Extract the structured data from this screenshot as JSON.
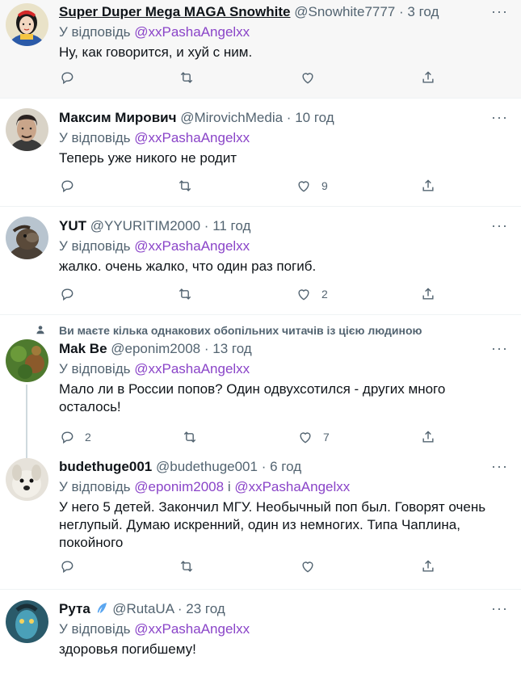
{
  "tweets": [
    {
      "name": "Super Duper Mega MAGA Snowhite",
      "handle": "@Snowhite7777",
      "time": "3 год",
      "reply_prefix": "У відповідь",
      "reply_to": "@xxPashaAngelxx",
      "reply_and": "",
      "reply_to2": "",
      "text": "Ну, как говорится, и хуй с ним.",
      "likes": ""
    },
    {
      "name": "Максим Мирович",
      "handle": "@MirovichMedia",
      "time": "10 год",
      "reply_prefix": "У відповідь",
      "reply_to": "@xxPashaAngelxx",
      "reply_and": "",
      "reply_to2": "",
      "text": "Теперь уже никого не родит",
      "likes": "9"
    },
    {
      "name": "YUT",
      "handle": "@YYURITIM2000",
      "time": "11 год",
      "reply_prefix": "У відповідь",
      "reply_to": "@xxPashaAngelxx",
      "reply_and": "",
      "reply_to2": "",
      "text": "жалко. очень жалко, что один раз погиб.",
      "likes": "2"
    },
    {
      "social_context": "Ви маєте кілька однакових обопільних читачів із цією людиною",
      "name": "Mak Be",
      "handle": "@eponim2008",
      "time": "13 год",
      "reply_prefix": "У відповідь",
      "reply_to": "@xxPashaAngelxx",
      "reply_and": "",
      "reply_to2": "",
      "text": "Мало ли в России попов? Один одвухсотился - других много осталось!",
      "replies": "2",
      "likes": "7"
    },
    {
      "name": "budethuge001",
      "handle": "@budethuge001",
      "time": "6 год",
      "reply_prefix": "У відповідь",
      "reply_to": "@eponim2008",
      "reply_and": "і",
      "reply_to2": "@xxPashaAngelxx",
      "text": "У него 5 детей. Закончил МГУ. Необычный поп был. Говорят очень неглупый. Думаю искренний, один из немногих. Типа Чаплина, покойного",
      "likes": ""
    },
    {
      "name": "Рута",
      "handle": "@RutaUA",
      "time": "23 год",
      "reply_prefix": "У відповідь",
      "reply_to": "@xxPashaAngelxx",
      "reply_and": "",
      "reply_to2": "",
      "text": "здоровья погибшему!",
      "likes": ""
    }
  ],
  "icons": {
    "reply": "reply-icon",
    "retweet": "retweet-icon",
    "like": "like-icon",
    "share": "share-icon",
    "more": "more-icon",
    "verified_like": "feather-icon"
  },
  "colors": {
    "mention_link": "#8a44c8",
    "secondary_text": "#536471",
    "highlight_bg": "#f7f7f7"
  }
}
